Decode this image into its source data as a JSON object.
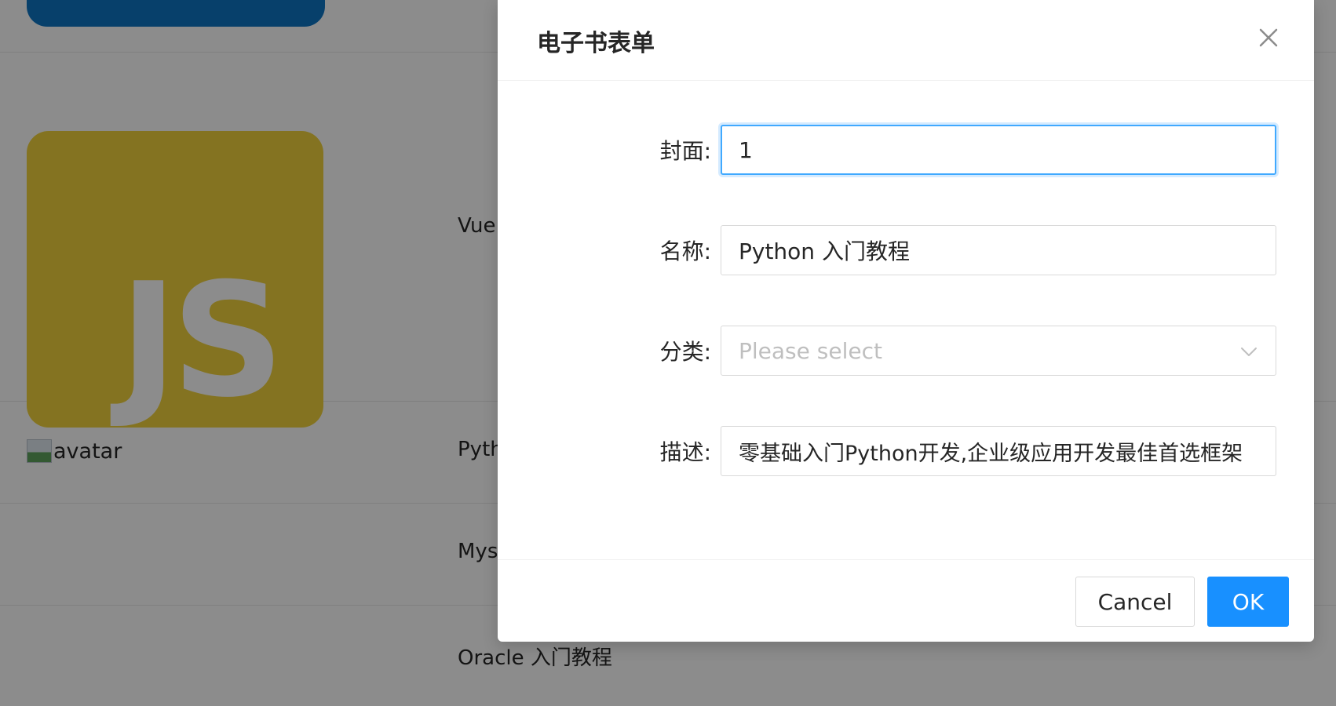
{
  "table": {
    "rows": [
      {
        "name": "Vue"
      },
      {
        "name": "Pyth",
        "avatar_alt": "avatar"
      },
      {
        "name": "Mys"
      },
      {
        "name": "Oracle 入门教程"
      }
    ],
    "js_logo_text": "JS"
  },
  "modal": {
    "title": "电子书表单",
    "close_icon": "close-icon",
    "fields": {
      "cover": {
        "label": "封面:",
        "value": "1"
      },
      "name": {
        "label": "名称:",
        "value": "Python 入门教程"
      },
      "category": {
        "label": "分类:",
        "placeholder": "Please select"
      },
      "description": {
        "label": "描述:",
        "value": "零基础入门Python开发,企业级应用开发最佳首选框架"
      }
    },
    "footer": {
      "cancel_label": "Cancel",
      "ok_label": "OK"
    }
  },
  "colors": {
    "primary": "#1890ff",
    "focus_border": "#40a9ff",
    "overlay": "rgba(0,0,0,0.45)",
    "js_logo_bg": "#f0d23c"
  }
}
